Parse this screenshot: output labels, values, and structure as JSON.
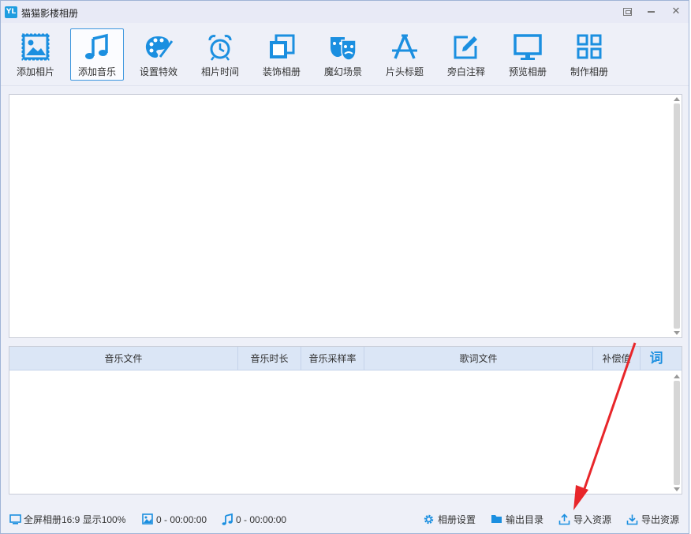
{
  "window": {
    "logo_text": "YL",
    "title": "猫猫影楼相册"
  },
  "toolbar": {
    "items": [
      {
        "label": "添加相片",
        "icon": "image-icon",
        "active": false
      },
      {
        "label": "添加音乐",
        "icon": "music-note-icon",
        "active": true
      },
      {
        "label": "设置特效",
        "icon": "palette-icon",
        "active": false
      },
      {
        "label": "相片时间",
        "icon": "alarm-clock-icon",
        "active": false
      },
      {
        "label": "装饰相册",
        "icon": "layers-icon",
        "active": false
      },
      {
        "label": "魔幻场景",
        "icon": "theater-masks-icon",
        "active": false
      },
      {
        "label": "片头标题",
        "icon": "title-a-icon",
        "active": false
      },
      {
        "label": "旁白注释",
        "icon": "edit-pencil-icon",
        "active": false
      },
      {
        "label": "预览相册",
        "icon": "monitor-icon",
        "active": false
      },
      {
        "label": "制作相册",
        "icon": "grid-icon",
        "active": false
      }
    ]
  },
  "music_table": {
    "columns": [
      "音乐文件",
      "音乐时长",
      "音乐采样率",
      "歌词文件",
      "补偿值"
    ],
    "lyric_button_label": "词",
    "rows": []
  },
  "statusbar": {
    "display_mode": "全屏相册16:9 显示100%",
    "photo_stats": "0 - 00:00:00",
    "music_stats": "0 - 00:00:00",
    "album_settings": "相册设置",
    "output_dir": "输出目录",
    "import_resources": "导入资源",
    "export_resources": "导出资源"
  },
  "colors": {
    "accent": "#1b8fe0",
    "annotation_arrow": "#e8262a",
    "header_bg": "#dbe6f6"
  }
}
